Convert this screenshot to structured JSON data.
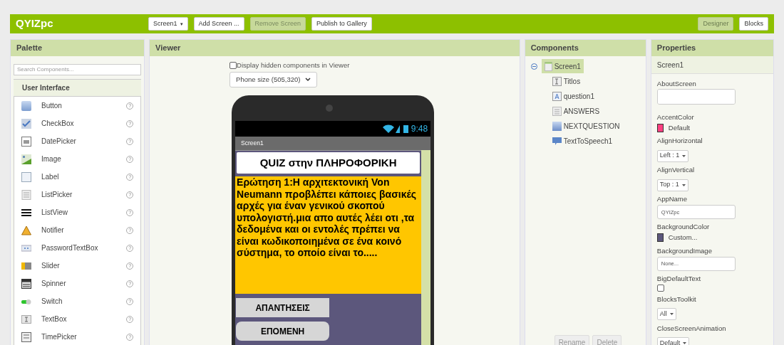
{
  "app_bar": {
    "title": "QYIZpc",
    "buttons": [
      {
        "label": "Screen1",
        "caret": "▾",
        "disabled": false
      },
      {
        "label": "Add Screen ...",
        "disabled": false
      },
      {
        "label": "Remove Screen",
        "disabled": true
      },
      {
        "label": "Publish to Gallery",
        "disabled": false
      }
    ],
    "mode_tabs": [
      {
        "label": "Designer",
        "selected": true
      },
      {
        "label": "Blocks",
        "selected": false
      }
    ]
  },
  "palette": {
    "title": "Palette",
    "search": {
      "placeholder": "Search Components..."
    },
    "category": "User Interface",
    "help": "?",
    "items": [
      {
        "label": "Button"
      },
      {
        "label": "CheckBox"
      },
      {
        "label": "DatePicker"
      },
      {
        "label": "Image"
      },
      {
        "label": "Label"
      },
      {
        "label": "ListPicker"
      },
      {
        "label": "ListView"
      },
      {
        "label": "Notifier"
      },
      {
        "label": "PasswordTextBox"
      },
      {
        "label": "Slider"
      },
      {
        "label": "Spinner"
      },
      {
        "label": "Switch"
      },
      {
        "label": "TextBox"
      },
      {
        "label": "TimePicker"
      }
    ]
  },
  "viewer": {
    "title": "Viewer",
    "hidden_toggle": {
      "label": "Display hidden components in Viewer",
      "checked": false
    },
    "size_select": "Phone size (505,320)",
    "phone": {
      "time": "9:48",
      "screen_title": "Screen1",
      "heading": "QUIZ στην ΠΛΗΡΟΦΟΡΙΚΗ",
      "question": "Ερώτηση 1:Η αρχιτεκτονική Von Neumann προβλέπει κάποιες βασικές αρχές για έναν γενικού σκοπού υπολογιστή.μια απο αυτές λέει οτι ,τα δεδομένα και οι εντολές πρέπει να είναι κωδικοποιημένα σε ένα κοινό σύστημα, το οποίο είναι το.....",
      "buttons": [
        {
          "label": "ΑΠΑΝΤΗΣΕΙΣ",
          "kind": "square"
        },
        {
          "label": "ΕΠΟΜΕΝΗ",
          "kind": "rounded"
        }
      ]
    }
  },
  "components": {
    "title": "Components",
    "tree": [
      {
        "label": "Screen1",
        "selected": true,
        "expanded": true,
        "children": [
          {
            "label": "Titlos",
            "selected": false
          },
          {
            "label": "question1",
            "selected": false
          },
          {
            "label": "ANSWERS",
            "selected": false
          },
          {
            "label": "NEXTQUESTION",
            "selected": false
          },
          {
            "label": "TextToSpeech1",
            "selected": false
          }
        ]
      }
    ],
    "buttons": [
      {
        "label": "Rename",
        "disabled": true
      },
      {
        "label": "Delete",
        "disabled": true
      }
    ]
  },
  "properties": {
    "title": "Properties",
    "subject": "Screen1",
    "items": [
      {
        "name": "AboutScreen",
        "kind": "textarea"
      },
      {
        "name": "AccentColor",
        "kind": "color",
        "value": "Default",
        "color": "#ff4081"
      },
      {
        "name": "AlignHorizontal",
        "kind": "dropdown",
        "value": "Left : 1"
      },
      {
        "name": "AlignVertical",
        "kind": "dropdown",
        "value": "Top : 1"
      },
      {
        "name": "AppName",
        "kind": "text",
        "value": "QYIZpc"
      },
      {
        "name": "BackgroundColor",
        "kind": "color",
        "value": "Custom...",
        "color": "#5c577c"
      },
      {
        "name": "BackgroundImage",
        "kind": "text",
        "value": "None..."
      },
      {
        "name": "BigDefaultText",
        "kind": "checkbox",
        "checked": false
      },
      {
        "name": "BlocksToolkit",
        "kind": "dropdown",
        "value": "All"
      },
      {
        "name": "CloseScreenAnimation",
        "kind": "dropdown",
        "value": "Default"
      }
    ]
  }
}
